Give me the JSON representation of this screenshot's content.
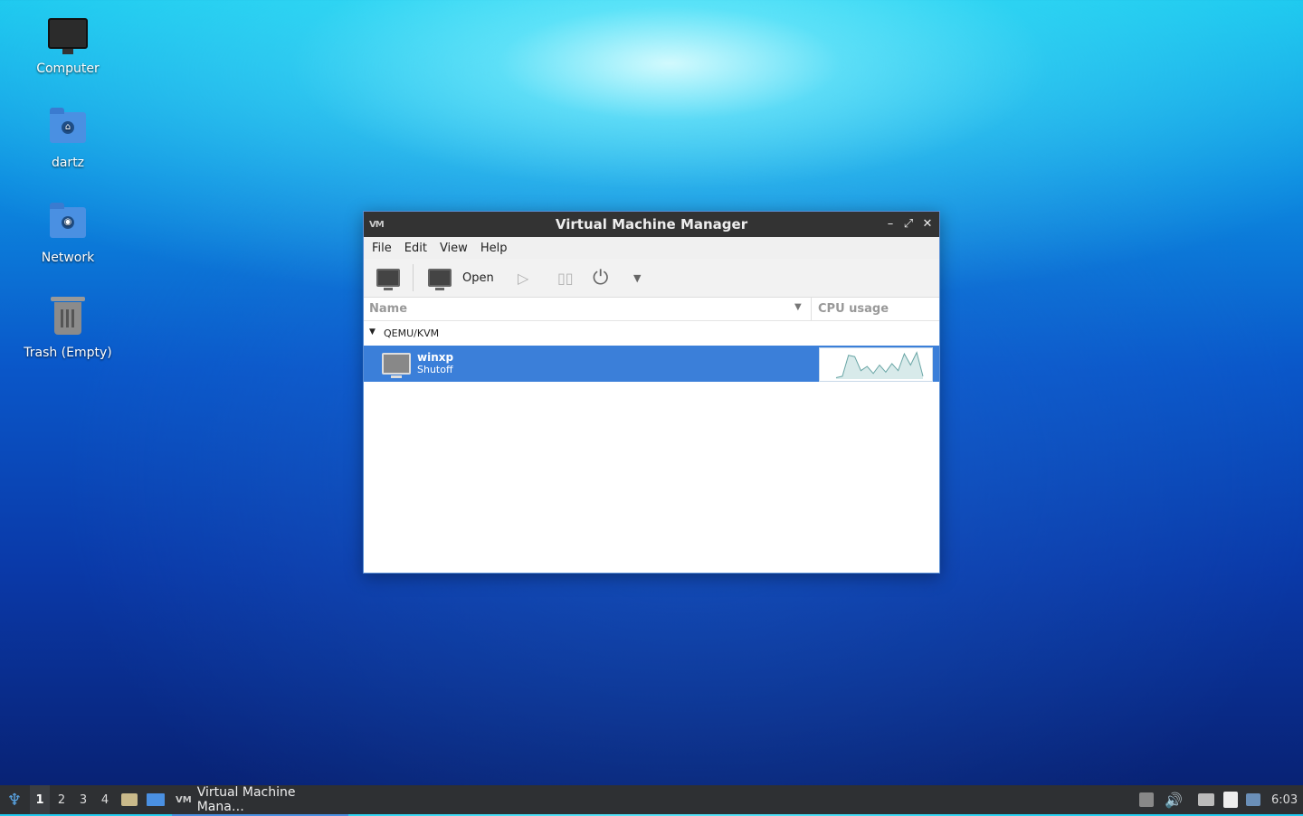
{
  "desktop": {
    "icons": [
      {
        "label": "Computer"
      },
      {
        "label": "dartz"
      },
      {
        "label": "Network"
      },
      {
        "label": "Trash (Empty)"
      }
    ]
  },
  "window": {
    "title": "Virtual Machine Manager",
    "menu": [
      "File",
      "Edit",
      "View",
      "Help"
    ],
    "toolbar": {
      "open_label": "Open"
    },
    "columns": {
      "name": "Name",
      "cpu": "CPU usage"
    },
    "group": {
      "label": "QEMU/KVM"
    },
    "vms": [
      {
        "name": "winxp",
        "status": "Shutoff",
        "cpu_history": [
          0.05,
          0.1,
          0.85,
          0.8,
          0.3,
          0.45,
          0.2,
          0.5,
          0.25,
          0.55,
          0.3,
          0.9,
          0.5,
          0.95,
          0.1
        ]
      }
    ]
  },
  "taskbar": {
    "workspaces": [
      "1",
      "2",
      "3",
      "4"
    ],
    "active_workspace": "1",
    "task_label": "Virtual Machine Mana…",
    "clock": "6:03"
  }
}
